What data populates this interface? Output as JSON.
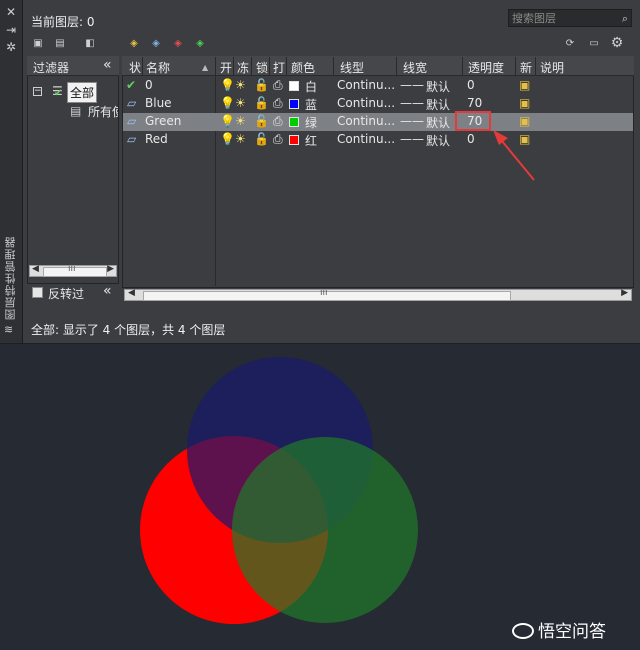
{
  "panel": {
    "current_layer_label": "当前图层: 0",
    "search_placeholder": "搜索图层",
    "side_title": "图层特性管理器",
    "side_close": "✕",
    "filter_header": "过滤器",
    "filter_collapse": "«",
    "filter_tree": {
      "root": "全部",
      "child": "所有使"
    },
    "invert_label": "反转过",
    "invert_collapse": "«",
    "status": "全部: 显示了 4 个图层，共 4 个图层"
  },
  "columns": [
    "状",
    "名称",
    "开",
    "冻",
    "锁",
    "打",
    "颜色",
    "线型",
    "线宽",
    "透明度",
    "新",
    "说明"
  ],
  "layers": [
    {
      "name": "0",
      "color_name": "白",
      "color_hex": "#ffffff",
      "linetype": "Continu...",
      "lineweight": "默认",
      "transparency": "0",
      "current": true,
      "selected": false
    },
    {
      "name": "Blue",
      "color_name": "蓝",
      "color_hex": "#0000ff",
      "linetype": "Continu...",
      "lineweight": "默认",
      "transparency": "70",
      "current": false,
      "selected": false
    },
    {
      "name": "Green",
      "color_name": "绿",
      "color_hex": "#00cc00",
      "linetype": "Continu...",
      "lineweight": "默认",
      "transparency": "70",
      "current": false,
      "selected": true
    },
    {
      "name": "Red",
      "color_name": "红",
      "color_hex": "#ff0000",
      "linetype": "Continu...",
      "lineweight": "默认",
      "transparency": "0",
      "current": false,
      "selected": false
    }
  ],
  "circles": [
    {
      "name": "blue-circle",
      "fill": "#1a1a6e"
    },
    {
      "name": "green-circle",
      "fill": "#1f7a2a"
    },
    {
      "name": "red-circle",
      "fill": "#ff0000"
    }
  ],
  "annotation_color": "#e33a3a",
  "watermark": "悟空问答"
}
